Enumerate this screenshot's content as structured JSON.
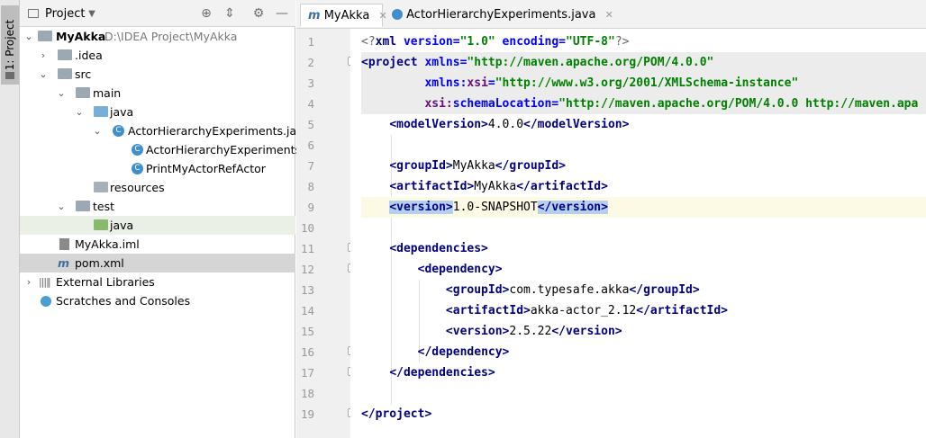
{
  "sidebar_strip": {
    "label": "1: Project"
  },
  "project_panel": {
    "title": "Project",
    "tree": [
      {
        "label": "MyAkka",
        "path": "D:\\IDEA Project\\MyAkka",
        "icon": "folder-icon"
      },
      {
        "label": ".idea",
        "icon": "folder-icon"
      },
      {
        "label": "src",
        "icon": "folder-icon"
      },
      {
        "label": "main",
        "icon": "folder-icon"
      },
      {
        "label": "java",
        "icon": "source-folder-icon"
      },
      {
        "label": "ActorHierarchyExperiments.java",
        "icon": "java-file-icon"
      },
      {
        "label": "ActorHierarchyExperiments",
        "icon": "class-icon"
      },
      {
        "label": "PrintMyActorRefActor",
        "icon": "class-icon"
      },
      {
        "label": "resources",
        "icon": "resources-folder-icon"
      },
      {
        "label": "test",
        "icon": "folder-icon"
      },
      {
        "label": "java",
        "icon": "test-folder-icon"
      },
      {
        "label": "MyAkka.iml",
        "icon": "module-file-icon"
      },
      {
        "label": "pom.xml",
        "icon": "maven-icon"
      },
      {
        "label": "External Libraries",
        "icon": "library-icon"
      },
      {
        "label": "Scratches and Consoles",
        "icon": "scratch-icon"
      }
    ]
  },
  "editor_tabs": [
    {
      "label": "MyAkka",
      "icon": "maven-icon",
      "active": true
    },
    {
      "label": "ActorHierarchyExperiments.java",
      "icon": "java-file-icon",
      "active": false
    }
  ],
  "editor": {
    "line_numbers": [
      "1",
      "2",
      "3",
      "4",
      "5",
      "6",
      "7",
      "8",
      "9",
      "10",
      "11",
      "12",
      "13",
      "14",
      "15",
      "16",
      "17",
      "18",
      "19"
    ],
    "tokens": {
      "xml_decl_open": "<?",
      "xml": "xml",
      "version_attr": " version=",
      "version_val": "\"1.0\"",
      "encoding_attr": " encoding=",
      "encoding_val": "\"UTF-8\"",
      "xml_decl_close": "?>",
      "project_open": "<project",
      "xmlns_attr": " xmlns=",
      "xmlns_val": "\"http://maven.apache.org/POM/4.0.0\"",
      "xmlns_prefix": "xmlns:",
      "xsi": "xsi",
      "eq": "=",
      "xsi_val": "\"http://www.w3.org/2001/XMLSchema-instance\"",
      "schema_prefix": "xsi:",
      "schema_attr": "schemaLocation",
      "schema_val": "\"http://maven.apache.org/POM/4.0.0 http://maven.apa",
      "model_open": "<modelVersion>",
      "model_val": "4.0.0",
      "model_close": "</modelVersion>",
      "group_open": "<groupId>",
      "group_val": "MyAkka",
      "group_close": "</groupId>",
      "artifact_open": "<artifactId>",
      "artifact_val": "MyAkka",
      "artifact_close": "</artifactId>",
      "version_open": "<version>",
      "version_val2": "1.0-SNAPSHOT",
      "version_close": "</version>",
      "deps_open": "<dependencies>",
      "dep_open": "<dependency>",
      "dep_group_val": "com.typesafe.akka",
      "dep_artifact_val": "akka-actor_2.12",
      "dep_version_val": "2.5.22",
      "dep_close": "</dependency>",
      "deps_close": "</dependencies>",
      "project_close": "</project>",
      "gt": ">"
    }
  }
}
